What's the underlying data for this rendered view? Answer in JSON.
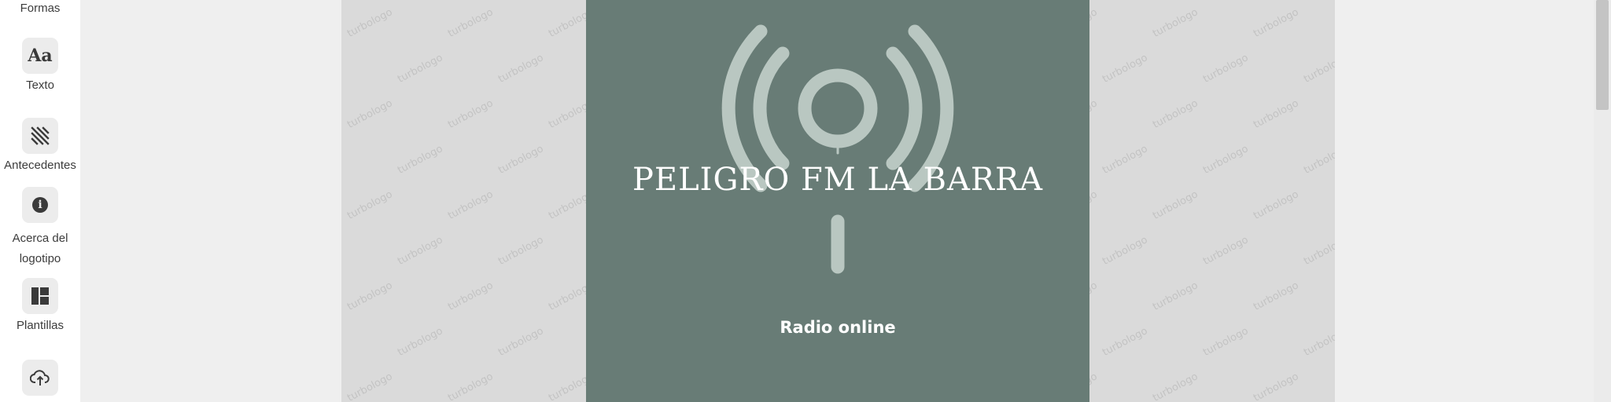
{
  "sidebar": {
    "items": [
      {
        "label": "Formas",
        "icon": "shapes-icon"
      },
      {
        "label": "Texto",
        "icon": "text-icon",
        "glyph": "Aa"
      },
      {
        "label": "Antecedentes",
        "icon": "background-pattern-icon"
      },
      {
        "label": "Acerca del logotipo",
        "icon": "info-icon",
        "glyph": "i"
      },
      {
        "label": "Plantillas",
        "icon": "templates-grid-icon"
      },
      {
        "label": "",
        "icon": "cloud-upload-icon"
      }
    ]
  },
  "canvas": {
    "watermark_text": "turbologo",
    "logo": {
      "title": "PELIGRO FM LA BARRA",
      "subtitle": "Radio online",
      "background_color": "#687c76",
      "symbol_color": "#b9c7c1",
      "symbol": "radio-broadcast-antenna-icon"
    }
  }
}
